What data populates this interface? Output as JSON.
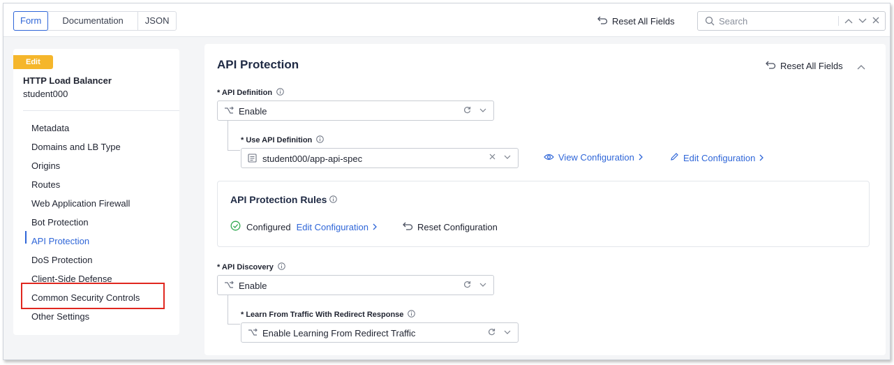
{
  "tabs": [
    "Form",
    "Documentation",
    "JSON"
  ],
  "topbar": {
    "reset_all": "Reset All Fields",
    "search_placeholder": "Search"
  },
  "sidebar": {
    "badge": "Edit",
    "title": "HTTP Load Balancer",
    "name": "student000",
    "items": [
      "Metadata",
      "Domains and LB Type",
      "Origins",
      "Routes",
      "Web Application Firewall",
      "Bot Protection",
      "API Protection",
      "DoS Protection",
      "Client-Side Defense",
      "Common Security Controls",
      "Other Settings"
    ],
    "active_item": "API Protection"
  },
  "main": {
    "title": "API Protection",
    "reset_all": "Reset All Fields",
    "api_definition": {
      "label": "* API Definition",
      "value": "Enable"
    },
    "use_api_definition": {
      "label": "* Use API Definition",
      "value": "student000/app-api-spec",
      "view_config": "View Configuration",
      "edit_config": "Edit Configuration"
    },
    "rules": {
      "title": "API Protection Rules",
      "status": "Configured",
      "edit": "Edit Configuration",
      "reset": "Reset Configuration"
    },
    "api_discovery": {
      "label": "* API Discovery",
      "value": "Enable"
    },
    "learn_from_traffic": {
      "label": "* Learn From Traffic With Redirect Response",
      "value": "Enable Learning From Redirect Traffic"
    }
  },
  "colors": {
    "accent": "#2f66d8",
    "badge": "#f5b62b",
    "highlight_box": "#e0271f",
    "success": "#2fa84f"
  },
  "icons": [
    "reset-icon",
    "search-icon",
    "chevron-up-icon",
    "chevron-down-icon",
    "close-icon",
    "info-icon",
    "branch-icon",
    "refresh-icon",
    "eye-icon",
    "pencil-icon",
    "chevron-right-icon",
    "check-circle-icon",
    "list-icon"
  ]
}
